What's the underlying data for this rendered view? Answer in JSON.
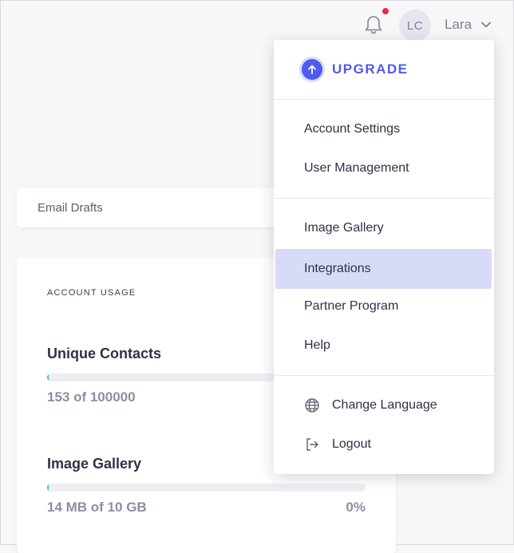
{
  "header": {
    "user_initials": "LC",
    "user_name": "Lara",
    "notification_dot_color": "#e8294a"
  },
  "drafts_card": {
    "label": "Email Drafts"
  },
  "usage": {
    "title": "ACCOUNT USAGE",
    "metrics": [
      {
        "name": "Unique Contacts",
        "value": "153 of 100000",
        "percent_label": "",
        "fill_fraction": 0.0015
      },
      {
        "name": "Image Gallery",
        "value": "14 MB of 10 GB",
        "percent_label": "0%",
        "fill_fraction": 0.0014
      }
    ]
  },
  "dropdown": {
    "upgrade_label": "UPGRADE",
    "accent_color": "#4f5bf0",
    "highlight_color": "#d8dbf7",
    "items": [
      {
        "label": "Account Settings"
      },
      {
        "label": "User Management"
      },
      {
        "label": "Image Gallery"
      },
      {
        "label": "Integrations",
        "highlighted": true
      },
      {
        "label": "Partner Program"
      },
      {
        "label": "Help"
      },
      {
        "label": "Change Language",
        "icon": "globe-icon"
      },
      {
        "label": "Logout",
        "icon": "logout-icon"
      }
    ]
  }
}
